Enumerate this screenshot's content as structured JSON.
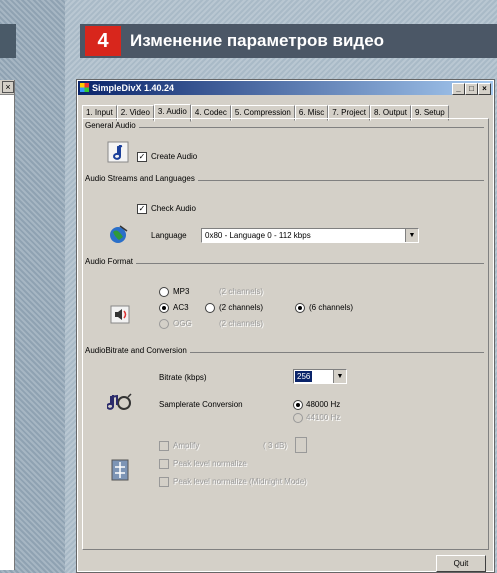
{
  "step": {
    "number": "4",
    "title": "Изменение параметров видео"
  },
  "window": {
    "title": "SimpleDivX 1.40.24",
    "minimize": "_",
    "maximize": "□",
    "close": "×"
  },
  "tabs": [
    "1. Input",
    "2. Video",
    "3. Audio",
    "4. Codec",
    "5. Compression",
    "6. Misc",
    "7. Project",
    "8. Output",
    "9. Setup"
  ],
  "general_audio": {
    "label": "General Audio",
    "create_audio": "Create Audio",
    "checkmark": "✓"
  },
  "streams": {
    "label": "Audio Streams and Languages",
    "check_audio": "Check Audio",
    "language_label": "Language",
    "language_value": "0x80 - Language 0 - 112 kbps"
  },
  "format": {
    "label": "Audio Format",
    "mp3": "MP3",
    "mp3_ch": "(2 channels)",
    "ac3": "AC3",
    "ac3_2ch": "(2 channels)",
    "ac3_6ch": "(6 channels)",
    "ogg": "OGG",
    "ogg_ch": "(2 channels)"
  },
  "bitrate": {
    "label": "AudioBitrate and Conversion",
    "bitrate_label": "Bitrate (kbps)",
    "bitrate_value": "256",
    "samplerate_label": "Samplerate Conversion",
    "rate_48": "48000 Hz",
    "rate_44": "44100 Hz",
    "amplify": "Amplify",
    "amplify_db": "( 3 dB)",
    "peak": "Peak level normalize",
    "peak_midnight": "Peak level normalize (Midnight Mode)"
  },
  "footer": {
    "quit": "Quit"
  }
}
